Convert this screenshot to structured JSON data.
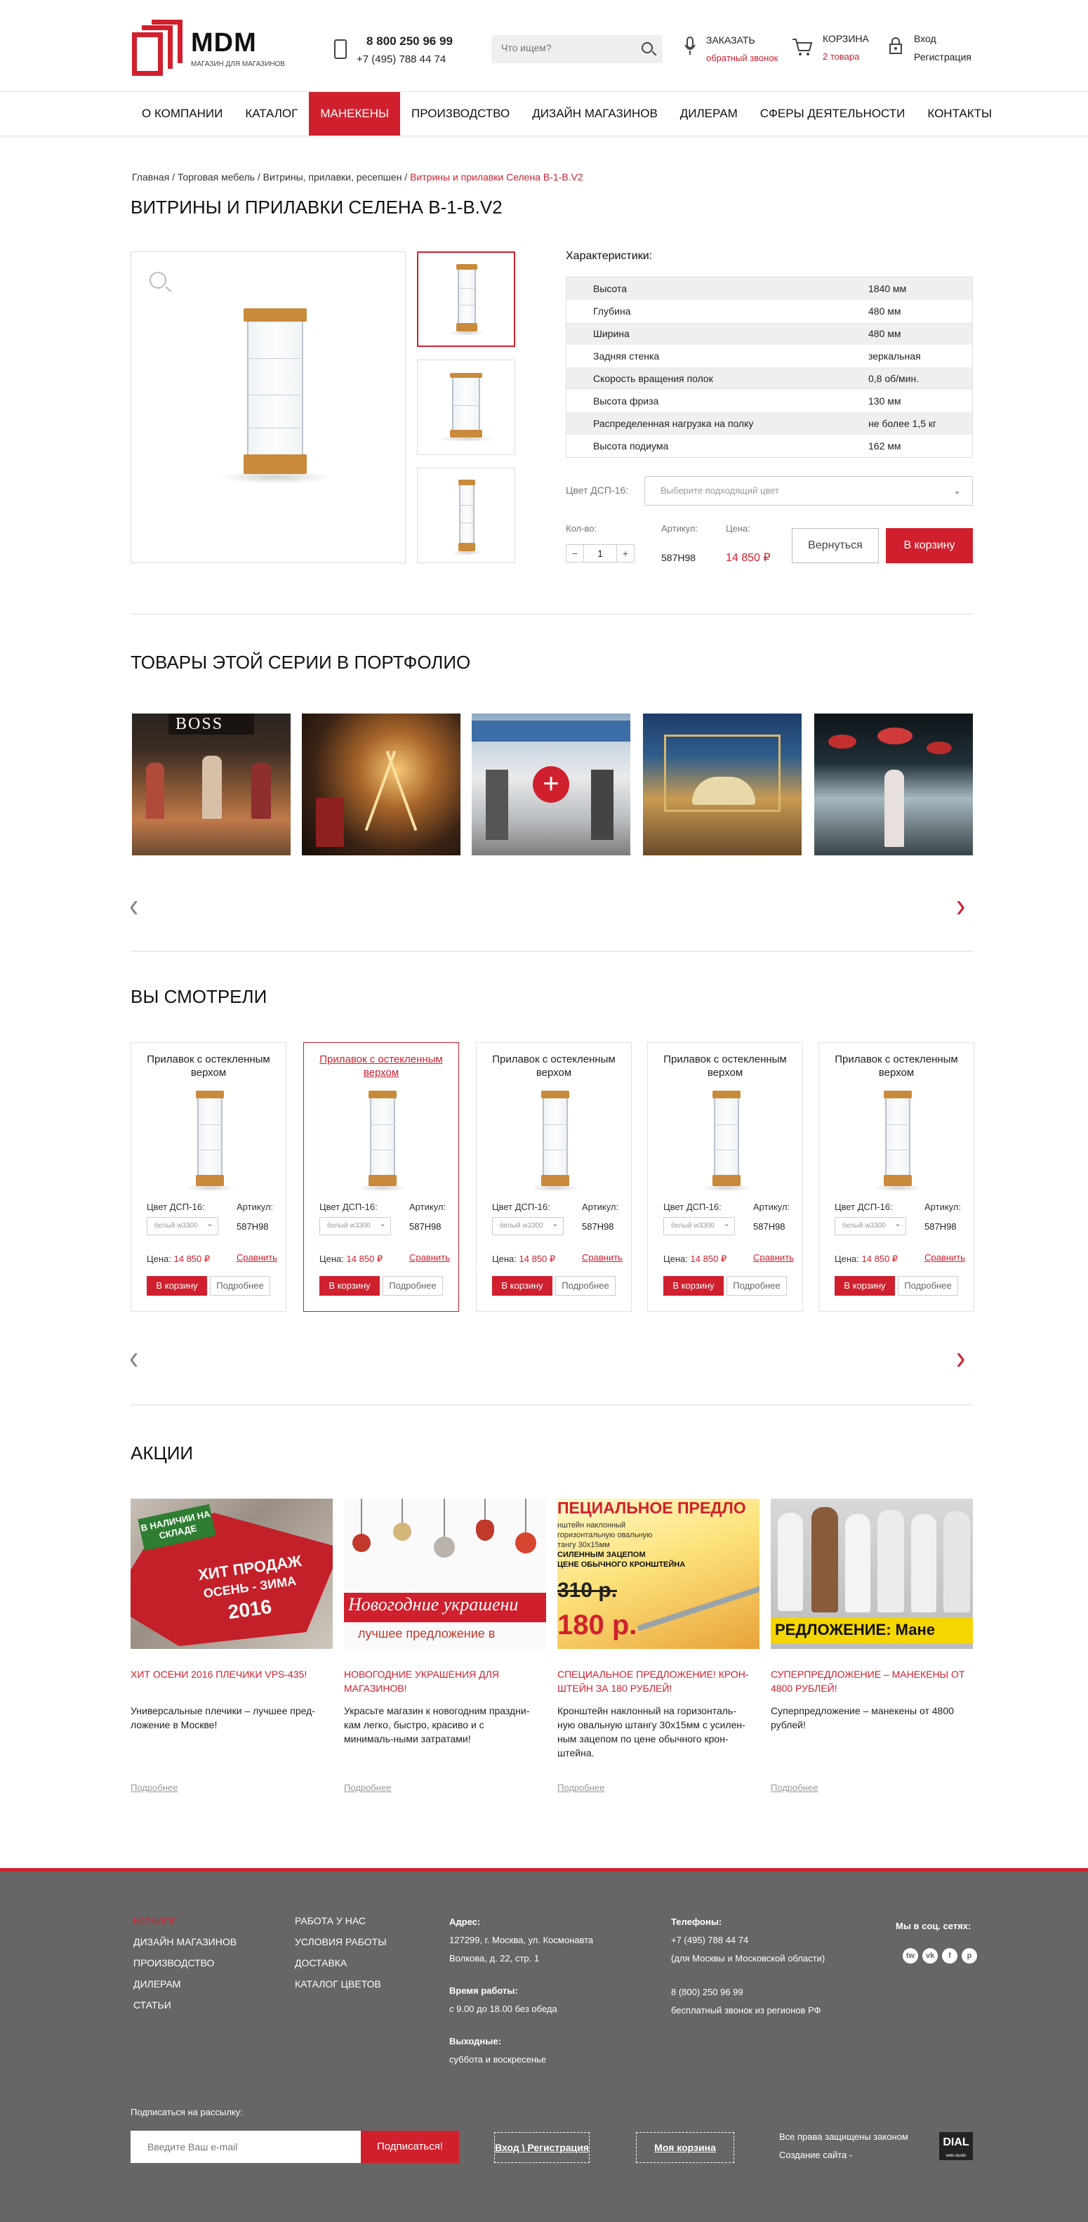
{
  "brand": {
    "name": "MDM",
    "tagline": "МАГАЗИН ДЛЯ МАГАЗИНОВ",
    "accent": "#d0202e"
  },
  "header": {
    "phone1": "8 800 250 96 99",
    "phone2": "+7 (495) 788 44 74",
    "search_placeholder": "Что ищем?",
    "callback_title": "ЗАКАЗАТЬ",
    "callback_sub": "обратный звонок",
    "cart_title": "КОРЗИНА",
    "cart_sub": "2 товара",
    "login": "Вход",
    "register": "Регистрация"
  },
  "nav": [
    "О КОМПАНИИ",
    "КАТАЛОГ",
    "МАНЕКЕНЫ",
    "ПРОИЗВОДСТВО",
    "ДИЗАЙН МАГАЗИНОВ",
    "ДИЛЕРАМ",
    "СФЕРЫ ДЕЯТЕЛЬНОСТИ",
    "КОНТАКТЫ"
  ],
  "nav_active": 2,
  "breadcrumbs": {
    "parts": "Главная / Торговая мебель / Витрины, прилавки, ресепшен / ",
    "current": "Витрины и прилавки Селена В-1-В.V2"
  },
  "product": {
    "title": "ВИТРИНЫ И ПРИЛАВКИ СЕЛЕНА В-1-В.V2",
    "specs_title": "Характеристики:",
    "specs": [
      {
        "k": "Высота",
        "v": "1840 мм"
      },
      {
        "k": "Глубина",
        "v": "480 мм"
      },
      {
        "k": "Ширина",
        "v": "480 мм"
      },
      {
        "k": "Задняя стенка",
        "v": "зеркальная"
      },
      {
        "k": "Скорость вращения полок",
        "v": "0,8 об/мин."
      },
      {
        "k": "Высота фриза",
        "v": "130 мм"
      },
      {
        "k": "Распределенная нагрузка на полку",
        "v": "не более 1,5 кг"
      },
      {
        "k": "Высота подиума",
        "v": "162 мм"
      }
    ],
    "color_label": "Цвет ДСП-16:",
    "color_placeholder": "Выберите подходящий цвет",
    "qty_label": "Кол-во:",
    "qty_minus": "−",
    "qty": "1",
    "qty_plus": "+",
    "article_label": "Артикул:",
    "article": "587Н98",
    "price_label": "Цена:",
    "price": "14 850 ₽",
    "back_button": "Вернуться",
    "cart_button": "В корзину"
  },
  "portfolio": {
    "title": "ТОВАРЫ ЭТОЙ СЕРИИ В ПОРТФОЛИО",
    "plus": "+",
    "prev": "‹",
    "next": "›"
  },
  "viewed": {
    "title": "ВЫ СМОТРЕЛИ",
    "prev": "‹",
    "next": "›",
    "cards": [
      {
        "name": "Прилавок с остекленным верхом",
        "color_label": "Цвет ДСП-16:",
        "color": "белый w3300",
        "article_label": "Артикул:",
        "article": "587Н98",
        "price_label": "Цена:",
        "price": "14 850 ₽",
        "compare": "Сравнить",
        "cart": "В корзину",
        "more": "Подробнее"
      },
      {
        "name": "Прилавок с остекленным верхом",
        "color_label": "Цвет ДСП-16:",
        "color": "белый w3300",
        "article_label": "Артикул:",
        "article": "587Н98",
        "price_label": "Цена:",
        "price": "14 850 ₽",
        "compare": "Сравнить",
        "cart": "В корзину",
        "more": "Подробнее"
      },
      {
        "name": "Прилавок с остекленным верхом",
        "color_label": "Цвет ДСП-16:",
        "color": "белый w3300",
        "article_label": "Артикул:",
        "article": "587Н98",
        "price_label": "Цена:",
        "price": "14 850 ₽",
        "compare": "Сравнить",
        "cart": "В корзину",
        "more": "Подробнее"
      },
      {
        "name": "Прилавок с остекленным верхом",
        "color_label": "Цвет ДСП-16:",
        "color": "белый w3300",
        "article_label": "Артикул:",
        "article": "587Н98",
        "price_label": "Цена:",
        "price": "14 850 ₽",
        "compare": "Сравнить",
        "cart": "В корзину",
        "more": "Подробнее"
      },
      {
        "name": "Прилавок с остекленным верхом",
        "color_label": "Цвет ДСП-16:",
        "color": "белый w3300",
        "article_label": "Артикул:",
        "article": "587Н98",
        "price_label": "Цена:",
        "price": "14 850 ₽",
        "compare": "Сравнить",
        "cart": "В корзину",
        "more": "Подробнее"
      }
    ]
  },
  "promo": {
    "title": "АКЦИИ",
    "items": [
      {
        "title": "ХИТ ОСЕНИ 2016 ПЛЕЧИКИ VPS-435!",
        "desc": "Универсальные плечики – лучшее пред-ложение в Москве!",
        "more": "Подробнее",
        "badge": "В НАЛИЧИИ НА СКЛАДЕ",
        "banner1": "ХИТ ПРОДАЖ",
        "banner2": "ОСЕНЬ - ЗИМА",
        "banner3": "2016"
      },
      {
        "title": "НОВОГОДНИЕ УКРАШЕНИЯ ДЛЯ МАГАЗИНОВ!",
        "desc": "Украсьте магазин к новогодним праздни-кам легко, быстро, красиво и с минималь-ными затратами!",
        "more": "Подробнее",
        "banner1": "Новогодние украшени",
        "banner2": "лучшее предложение в"
      },
      {
        "title": "СПЕЦИАЛЬНОЕ ПРЕДЛОЖЕНИЕ! КРОН-ШТЕЙН ЗА 180 РУБЛЕЙ!",
        "desc": "Кронштейн наклонный на горизонталь-ную овальную штангу 30х15мм с усилен-ным зацепом по цене обычного крон-штейна.",
        "more": "Подробнее",
        "banner1": "ПЕЦИАЛЬНОЕ ПРЕДЛО",
        "banner2": "нштейн наклонный",
        "banner3": "горизонтальную овальную",
        "banner4": "тангу 30х15мм",
        "banner5": "СИЛЕННЫМ ЗАЦЕПОМ",
        "banner6": "ЦЕНЕ ОБЫЧНОГО КРОНШТЕЙНА",
        "old_price": "310 р.",
        "new_price": "180 р."
      },
      {
        "title": "СУПЕРПРЕДЛОЖЕНИЕ – МАНЕКЕНЫ ОТ 4800 РУБЛЕЙ!",
        "desc": "Суперпредложение – манекены от 4800 рублей!",
        "more": "Подробнее",
        "banner1": "РЕДЛОЖЕНИЕ: Мане"
      }
    ]
  },
  "footer": {
    "col1": [
      "КАТАЛОГ",
      "ДИЗАЙН МАГАЗИНОВ",
      "ПРОИЗВОДСТВО",
      "ДИЛЕРАМ",
      "СТАТЬИ"
    ],
    "col2": [
      "РАБОТА У НАС",
      "УСЛОВИЯ РАБОТЫ",
      "ДОСТАВКА",
      "КАТАЛОГ ЦВЕТОВ"
    ],
    "address_label": "Адрес:",
    "address": "127299, г. Москва, ул. Космонавта Волкова, д. 22, стр. 1",
    "hours_label": "Время работы:",
    "hours": "с 9.00 до 18.00 без обеда",
    "weekend_label": "Выходные:",
    "weekend": "суббота и воскресенье",
    "phones_label": "Телефоны:",
    "phone1": "+7 (495) 788 44 74",
    "phone1_note": "(для Москвы и Московской области)",
    "phone2": "8 (800) 250 96 99",
    "phone2_note": "бесплатный звонок из регионов РФ",
    "social_label": "Мы в соц. сетях:",
    "social": [
      "tw",
      "vk",
      "f",
      "p"
    ],
    "subscribe_label": "Подписаться на рассылку:",
    "subscribe_placeholder": "Введите Ваш e-mail",
    "subscribe_button": "Подписаться!",
    "login_link": "Вход \\ Регистрация",
    "cart_link": "Моя корзина",
    "copyright": "Все права защищены законом",
    "made_by": "Создание сайта -",
    "studio": "DIAL",
    "studio_sub": "web-studio"
  }
}
